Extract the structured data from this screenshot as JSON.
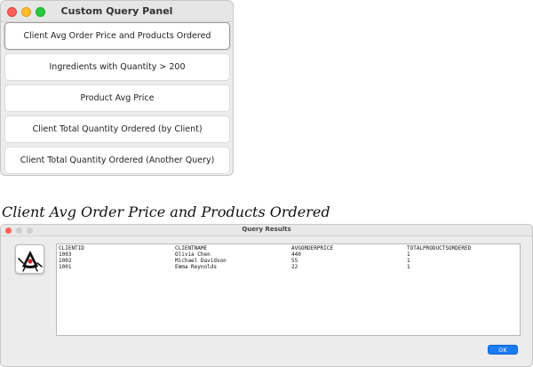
{
  "panel": {
    "title": "Custom Query Panel",
    "buttons": [
      "Client Avg Order Price and Products Ordered",
      "Ingredients with Quantity > 200",
      "Product Avg Price",
      "Client Total Quantity Ordered (by Client)",
      "Client Total Quantity Ordered (Another Query)"
    ]
  },
  "heading": "Client Avg Order Price and Products Ordered",
  "results": {
    "title": "Query Results",
    "icon": "java-duke-icon",
    "columns": [
      "CLIENTID",
      "CLIENTNAME",
      "AVGORDERPRICE",
      "TOTALPRODUCTSORDERED"
    ],
    "rows": [
      [
        "1003",
        "Olivia Chen",
        "440",
        "1"
      ],
      [
        "1002",
        "Michael Davidson",
        "55",
        "1"
      ],
      [
        "1001",
        "Emma Reynolds",
        "22",
        "1"
      ]
    ],
    "ok_label": "OK"
  },
  "colors": {
    "accent": "#1a7cf5",
    "close": "#fe5f57",
    "minimize": "#febc2e",
    "zoom": "#28c840"
  }
}
